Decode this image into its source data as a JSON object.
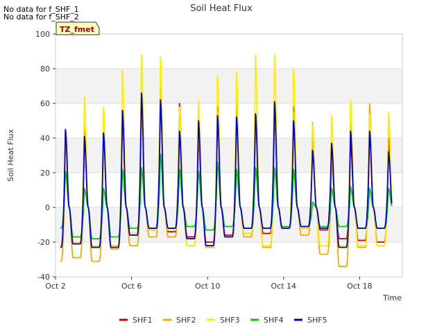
{
  "notes": [
    "No data for f_SHF_1",
    "No data for f_SHF_2"
  ],
  "badge": "TZ_fmet",
  "chart_data": {
    "type": "line",
    "title": "Soil Heat Flux",
    "xlabel": "Time",
    "ylabel": "Soil Heat Flux",
    "ylim": [
      -40,
      100
    ],
    "yticks": [
      -40,
      -20,
      0,
      20,
      40,
      60,
      80,
      100
    ],
    "xlim": [
      "2000-10-02",
      "2000-10-20"
    ],
    "xticks": [
      {
        "date": "2000-10-02",
        "label": "Oct 2"
      },
      {
        "date": "2000-10-06",
        "label": "Oct 6"
      },
      {
        "date": "2000-10-10",
        "label": "Oct 10"
      },
      {
        "date": "2000-10-14",
        "label": "Oct 14"
      },
      {
        "date": "2000-10-18",
        "label": "Oct 18"
      }
    ],
    "legend_position": "bottom",
    "series": [
      {
        "name": "SHF1",
        "color": "#cc0000",
        "daily_min": [
          -22,
          -21,
          -23,
          -22,
          -15,
          -13,
          -14,
          -17,
          -20,
          -16,
          -15,
          -15,
          -12,
          -12,
          -13,
          -18,
          -19,
          -20,
          -12
        ],
        "daily_max": [
          44,
          40,
          43,
          55,
          62,
          63,
          60,
          40,
          58,
          65,
          54,
          55,
          58,
          45,
          35,
          38,
          44,
          40
        ]
      },
      {
        "name": "SHF2",
        "color": "#f5a800",
        "daily_min": [
          -31,
          -29,
          -31,
          -24,
          -22,
          -17,
          -17,
          -22,
          -23,
          -17,
          -17,
          -23,
          -12,
          -16,
          -27,
          -34,
          -23,
          -22,
          -13
        ],
        "daily_max": [
          38,
          46,
          42,
          50,
          60,
          70,
          58,
          42,
          55,
          68,
          50,
          55,
          55,
          49,
          25,
          48,
          60,
          53
        ]
      },
      {
        "name": "SHF3",
        "color": "#ffee00",
        "daily_min": [
          -22,
          -20,
          -22,
          -22,
          -15,
          -13,
          -13,
          -22,
          -22,
          -17,
          -15,
          -22,
          -11,
          -12,
          -22,
          -22,
          -22,
          -22,
          -11
        ],
        "daily_max": [
          42,
          64,
          58,
          79,
          88,
          87,
          58,
          62,
          76,
          78,
          88,
          88,
          80,
          48,
          53,
          62,
          54,
          55
        ]
      },
      {
        "name": "SHF4",
        "color": "#00cc00",
        "daily_min": [
          -12,
          -17,
          -18,
          -17,
          -12,
          -12,
          -12,
          -11,
          -13,
          -11,
          -12,
          -12,
          -11,
          -11,
          -11,
          -11,
          -12,
          -12,
          -11
        ],
        "daily_max": [
          21,
          11,
          11,
          22,
          23,
          31,
          22,
          21,
          26,
          22,
          23,
          23,
          22,
          3,
          11,
          12,
          11,
          11
        ]
      },
      {
        "name": "SHF5",
        "color": "#0000cc",
        "daily_min": [
          -23,
          -21,
          -23,
          -23,
          -16,
          -12,
          -12,
          -18,
          -22,
          -17,
          -12,
          -12,
          -12,
          -11,
          -12,
          -23,
          -12,
          -12,
          -12
        ],
        "daily_max": [
          45,
          41,
          43,
          56,
          66,
          62,
          44,
          50,
          53,
          52,
          54,
          61,
          50,
          33,
          37,
          44,
          44,
          32
        ]
      }
    ]
  }
}
